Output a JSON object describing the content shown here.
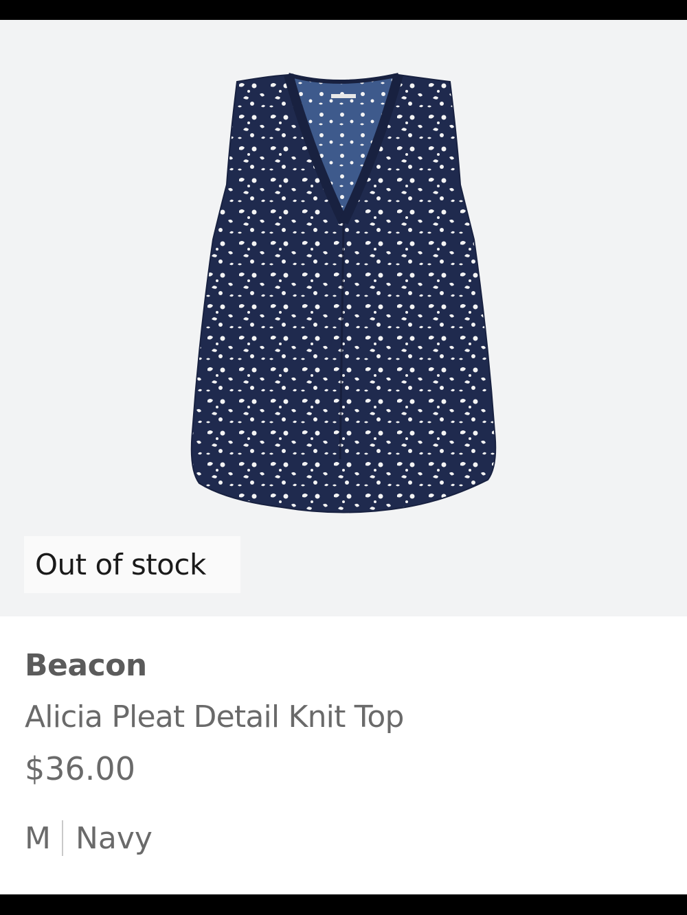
{
  "product": {
    "status_badge": "Out of stock",
    "brand": "Beacon",
    "name": "Alicia Pleat Detail Knit Top",
    "price": "$36.00",
    "size": "M",
    "color": "Navy"
  },
  "image": {
    "garment_color": "#1f2a4e",
    "print_color": "#f4f4f4",
    "background_color": "#f2f3f4"
  }
}
